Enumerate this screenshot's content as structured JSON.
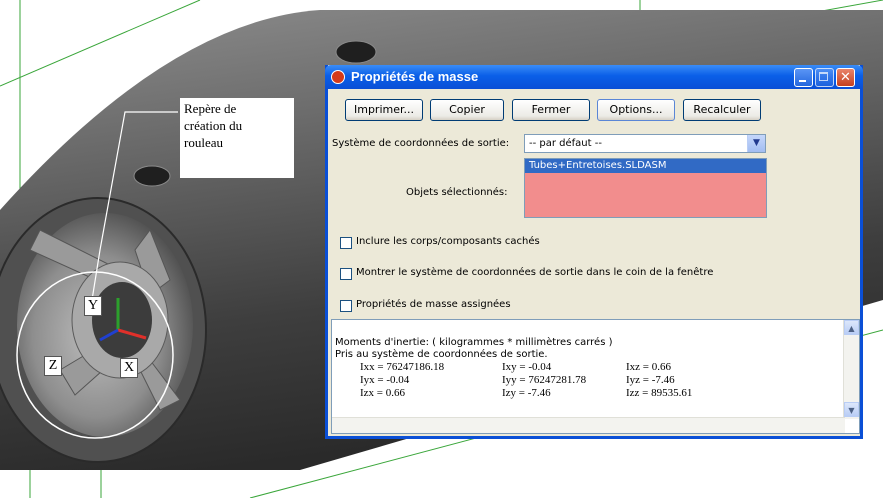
{
  "callouts": {
    "frame_label": [
      "Repère de",
      "création du",
      "rouleau"
    ],
    "axis_y": "Y",
    "axis_z": "Z",
    "axis_x": "X"
  },
  "dialog": {
    "title": "Propriétés de masse",
    "buttons": {
      "print": "Imprimer...",
      "copy": "Copier",
      "close": "Fermer",
      "options": "Options...",
      "recalc": "Recalculer"
    },
    "coord_system_label": "Système de coordonnées de sortie:",
    "coord_system_value": "-- par défaut --",
    "selected_objects_label": "Objets sélectionnés:",
    "selected_objects": [
      "Tubes+Entretoises.SLDASM"
    ],
    "checkboxes": [
      {
        "label": "Inclure les corps/composants cachés",
        "checked": false
      },
      {
        "label": "Montrer le système de coordonnées de sortie dans le coin de la fenêtre",
        "checked": false
      },
      {
        "label": "Propriétés de masse assignées",
        "checked": false
      }
    ],
    "results": {
      "heading": "Moments d'inertie: ( kilogrammes * millimètres carrés )",
      "subheading": "Pris au système de coordonnées de sortie.",
      "matrix": [
        [
          "Ixx = 76247186.18",
          "Ixy = -0.04",
          "Ixz = 0.66"
        ],
        [
          "Iyx = -0.04",
          "Iyy = 76247281.78",
          "Iyz = -7.46"
        ],
        [
          "Izx = 0.66",
          "Izy = -7.46",
          "Izz = 89535.61"
        ]
      ]
    }
  },
  "colors": {
    "titlebar": "#0a4fd6",
    "dialog_bg": "#ece9d8",
    "selection": "#316ac5",
    "list_bg": "#f28d8d",
    "axis_x": "#e0302a",
    "axis_y": "#2ca02c",
    "axis_z": "#2040d0"
  },
  "icons": {
    "app": "solidworks-icon",
    "minimize": "minimize-icon",
    "maximize": "maximize-icon",
    "close": "close-icon",
    "dropdown": "chevron-down-icon",
    "scroll_up": "scroll-up-icon",
    "scroll_down": "scroll-down-icon"
  }
}
